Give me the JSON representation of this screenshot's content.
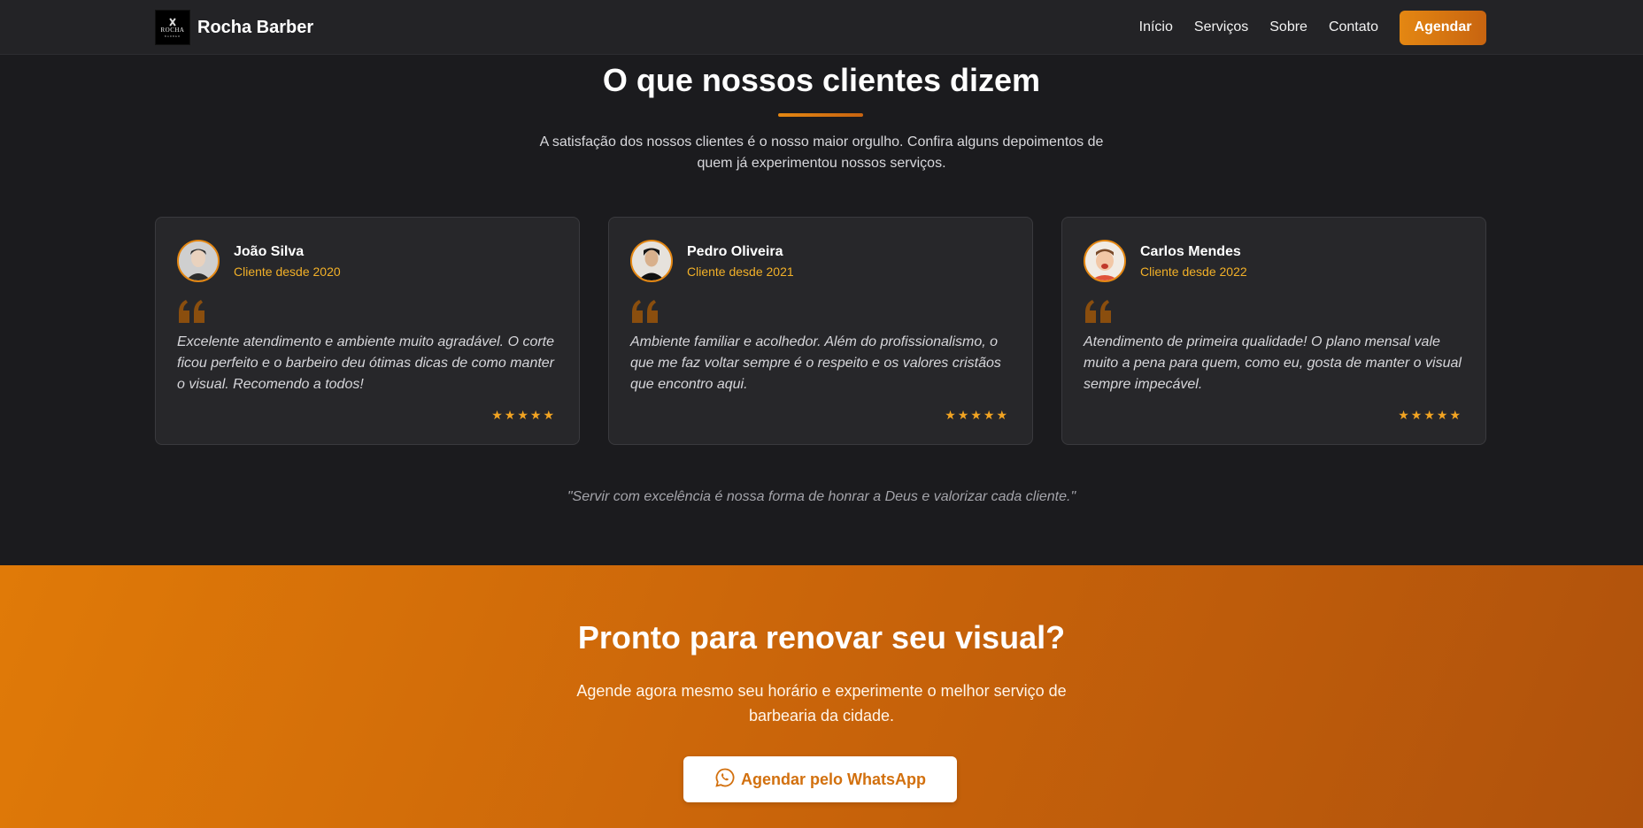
{
  "brand": {
    "name": "Rocha Barber",
    "logo_text": "ROCHA",
    "logo_sub": "BARBER"
  },
  "nav": {
    "links": [
      "Início",
      "Serviços",
      "Sobre",
      "Contato"
    ],
    "cta": "Agendar"
  },
  "testimonials": {
    "title": "O que nossos clientes dizem",
    "subtitle": "A satisfação dos nossos clientes é o nosso maior orgulho. Confira alguns depoimentos de quem já experimentou nossos serviços.",
    "cards": [
      {
        "name": "João Silva",
        "since": "Cliente desde 2020",
        "text": "Excelente atendimento e ambiente muito agradável. O corte ficou perfeito e o barbeiro deu ótimas dicas de como manter o visual. Recomendo a todos!",
        "stars": "★★★★★",
        "rating": 5
      },
      {
        "name": "Pedro Oliveira",
        "since": "Cliente desde 2021",
        "text": "Ambiente familiar e acolhedor. Além do profissionalismo, o que me faz voltar sempre é o respeito e os valores cristãos que encontro aqui.",
        "stars": "★★★★★",
        "rating": 5
      },
      {
        "name": "Carlos Mendes",
        "since": "Cliente desde 2022",
        "text": "Atendimento de primeira qualidade! O plano mensal vale muito a pena para quem, como eu, gosta de manter o visual sempre impecável.",
        "stars": "★★★★★",
        "rating": 5
      }
    ],
    "motto": "\"Servir com excelência é nossa forma de honrar a Deus e valorizar cada cliente.\""
  },
  "cta": {
    "title": "Pronto para renovar seu visual?",
    "text": "Agende agora mesmo seu horário e experimente o melhor serviço de barbearia da cidade.",
    "button": "Agendar pelo WhatsApp",
    "button_icon": "whatsapp-icon"
  },
  "colors": {
    "accent": "#e48712",
    "accent_dark": "#c86410",
    "gold_text": "#f2b028",
    "page_bg": "#1b1b1e",
    "card_bg": "#27272a"
  }
}
